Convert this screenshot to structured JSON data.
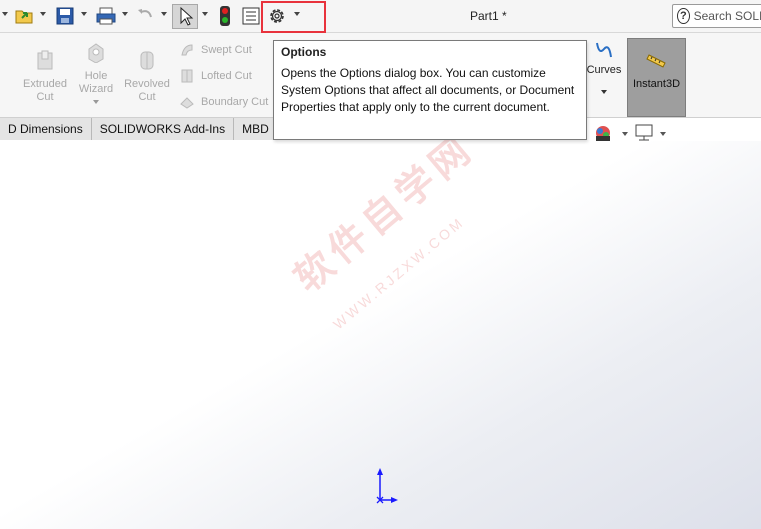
{
  "title_bar": {
    "document_title": "Part1 *",
    "search_placeholder": "Search SOLID",
    "buttons": [
      "new",
      "open",
      "save",
      "print",
      "undo",
      "select",
      "rebuild",
      "file-properties",
      "options"
    ]
  },
  "ribbon": {
    "large_tools": [
      {
        "label_line1": "Extruded",
        "label_line2": "Cut"
      },
      {
        "label_line1": "Hole",
        "label_line2": "Wizard"
      },
      {
        "label_line1": "Revolved",
        "label_line2": "Cut"
      }
    ],
    "small_tools": [
      "Swept Cut",
      "Lofted Cut",
      "Boundary Cut"
    ],
    "curves_label": "Curves",
    "instant3d_label": "Instant3D"
  },
  "tabs": [
    "D Dimensions",
    "SOLIDWORKS Add-Ins",
    "MBD"
  ],
  "tooltip": {
    "title": "Options",
    "body": "Opens the Options dialog box. You can customize System Options that affect all documents, or Document Properties that apply only to the current document."
  },
  "watermark": {
    "main": "软件自学网",
    "sub": "WWW.RJZXW.COM"
  },
  "colors": {
    "highlight": "#e8323c",
    "instant3d_bg": "#9e9e9e",
    "triad": "#1a1aff"
  }
}
